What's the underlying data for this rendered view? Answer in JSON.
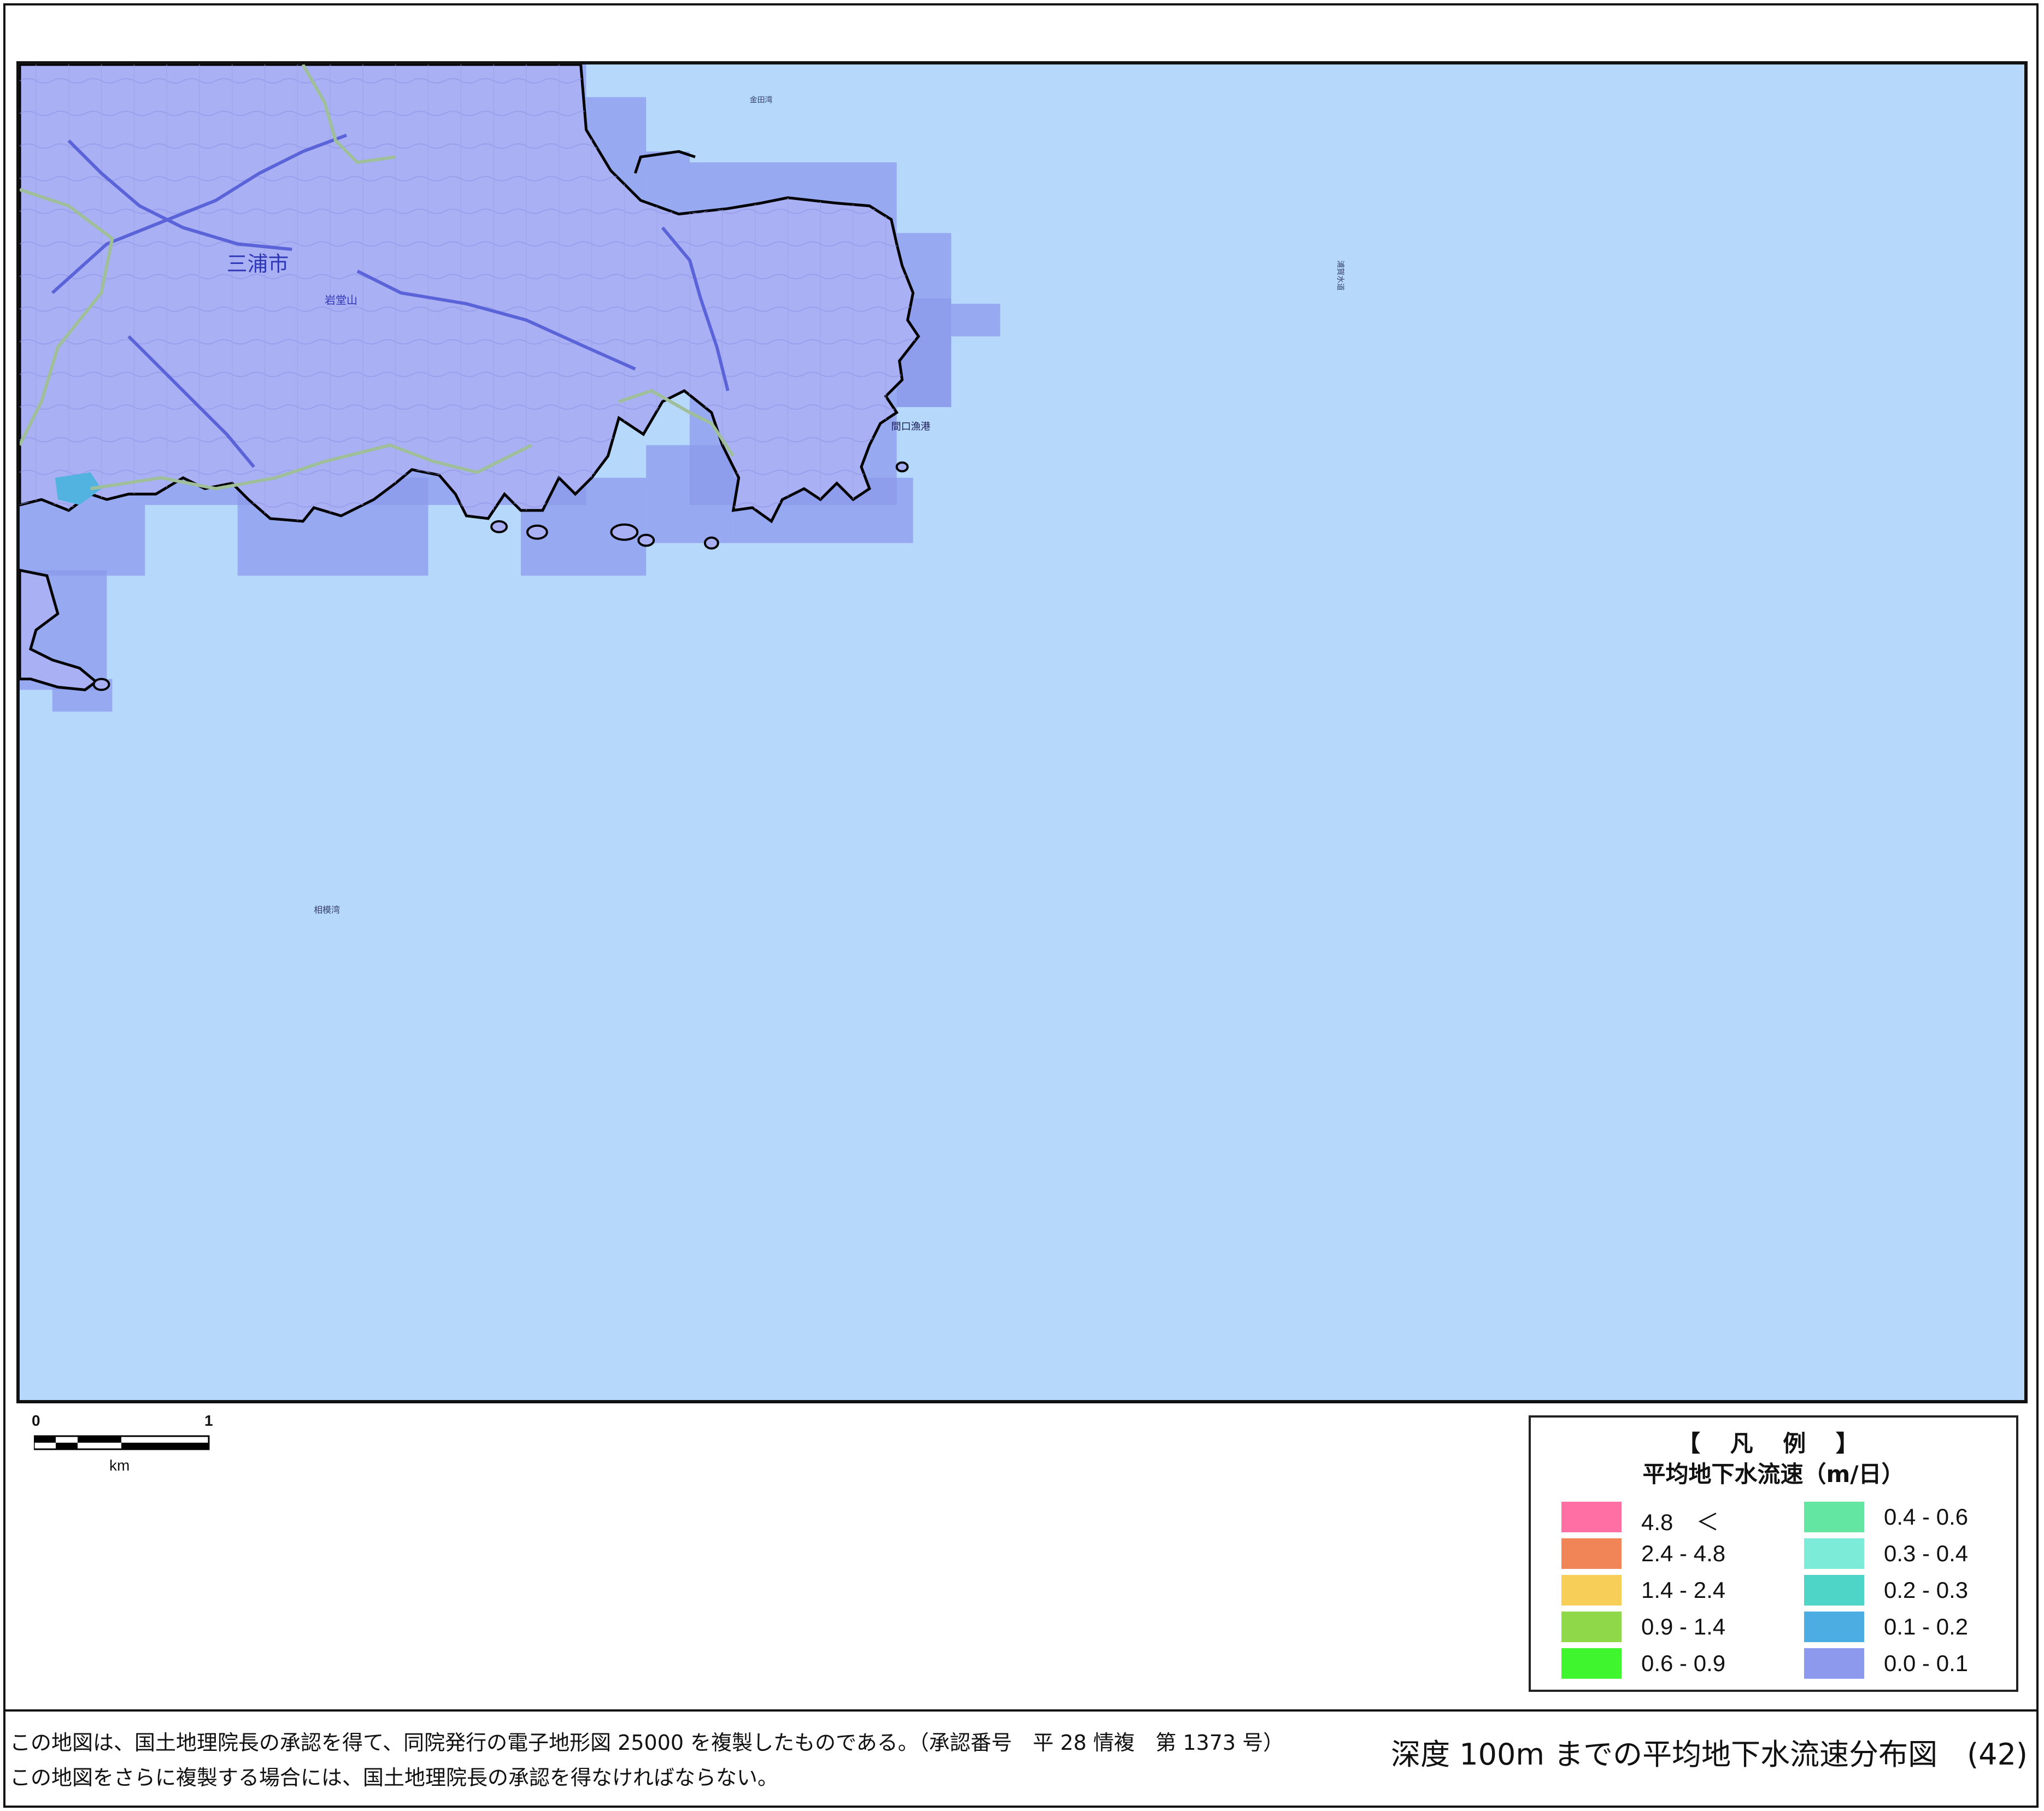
{
  "map": {
    "place_labels": {
      "city": "三浦市",
      "mountain": "岩堂山",
      "port": "間口漁港",
      "bay": "相模湾",
      "sea_east": "浦賀水道",
      "harbor_north": "金田湾"
    },
    "colors": {
      "sea": "#b6d8fb",
      "land": "#a9b0f3",
      "land_grid": "#8d93e8",
      "coast": "#000000",
      "road": "#5b63d8",
      "boundary": "#9fbf9a",
      "pond": "#53b3e0"
    }
  },
  "scale": {
    "zero": "0",
    "one": "1",
    "unit": "km"
  },
  "legend": {
    "title": "【 凡 例 】",
    "subtitle": "平均地下水流速（m/日）",
    "items": [
      {
        "label": "4.8　＜",
        "color": "#ff6fa3"
      },
      {
        "label": "2.4 ‐ 4.8",
        "color": "#f28557"
      },
      {
        "label": "1.4 ‐ 2.4",
        "color": "#f7cf58"
      },
      {
        "label": "0.9 ‐ 1.4",
        "color": "#8fd84a"
      },
      {
        "label": "0.6 ‐ 0.9",
        "color": "#3ff52d"
      },
      {
        "label": "0.4 ‐ 0.6",
        "color": "#63e6a2"
      },
      {
        "label": "0.3 ‐ 0.4",
        "color": "#7cecd9"
      },
      {
        "label": "0.2 ‐ 0.3",
        "color": "#4fd5c8"
      },
      {
        "label": "0.1 ‐ 0.2",
        "color": "#4bade2"
      },
      {
        "label": "0.0 ‐ 0.1",
        "color": "#8c99ec"
      }
    ]
  },
  "footer": {
    "note1": "この地図は、国土地理院長の承認を得て、同院発行の電子地形図 25000 を複製したものである。（承認番号　平 28 情複　第 1373 号）",
    "note2": "この地図をさらに複製する場合には、国土地理院長の承認を得なければならない。",
    "title": "深度 100m までの平均地下水流速分布図　(42)"
  }
}
